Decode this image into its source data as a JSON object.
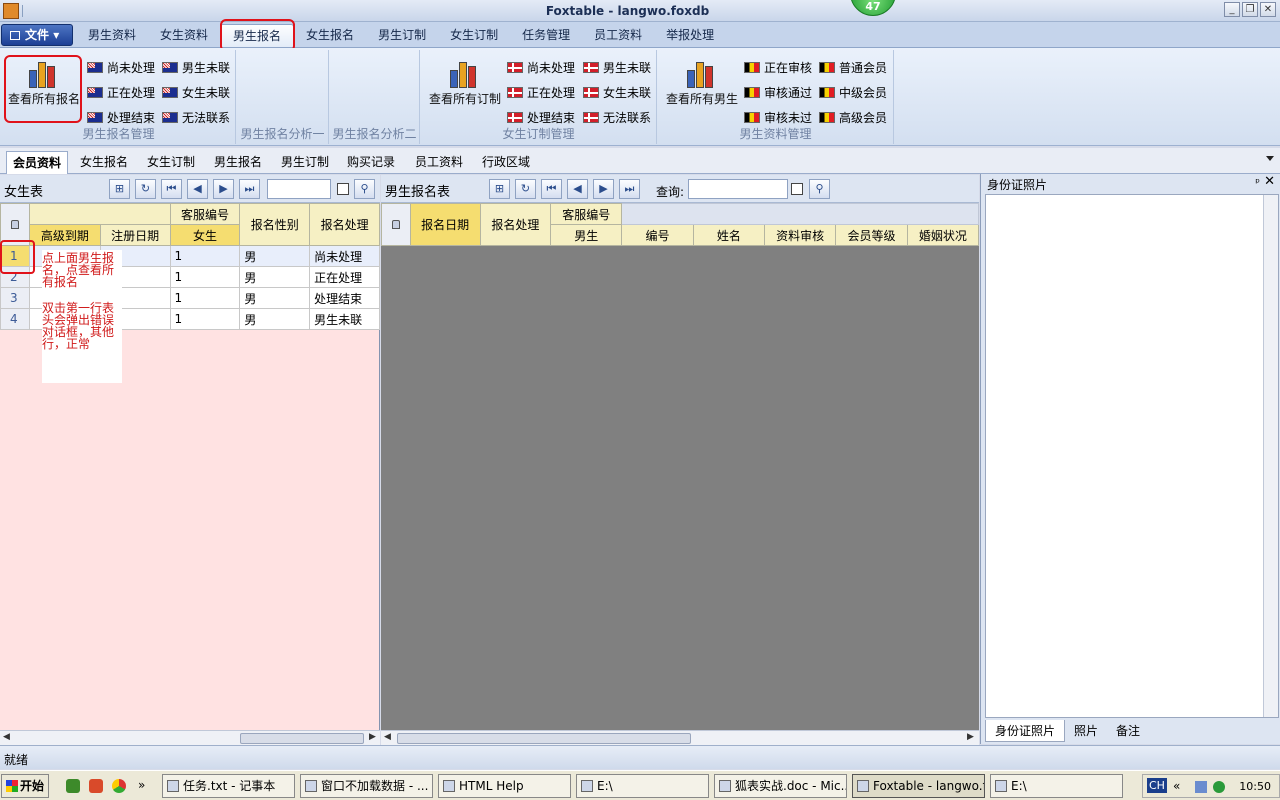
{
  "window": {
    "title": "Foxtable - langwo.foxdb",
    "badge": "47",
    "buttons": [
      "_",
      "❐",
      "✕"
    ]
  },
  "ribbon_tabs": {
    "file": "文件",
    "items": [
      "男生资料",
      "女生资料",
      "男生报名",
      "女生报名",
      "男生订制",
      "女生订制",
      "任务管理",
      "员工资料",
      "举报处理"
    ],
    "active": "男生报名"
  },
  "ribbon": {
    "group1": {
      "label": "男生报名管理",
      "big": "查看所有报名",
      "small": [
        "尚未处理",
        "男生未联",
        "正在处理",
        "女生未联",
        "处理结束",
        "无法联系"
      ]
    },
    "group2": {
      "label": "男生报名分析一"
    },
    "group3": {
      "label": "男生报名分析二"
    },
    "group4": {
      "label": "女生订制管理",
      "big": "查看所有订制",
      "small": [
        "尚未处理",
        "男生未联",
        "正在处理",
        "女生未联",
        "处理结束",
        "无法联系"
      ]
    },
    "group5": {
      "label": "男生资料管理",
      "big": "查看所有男生",
      "small": [
        "正在审核",
        "普通会员",
        "审核通过",
        "中级会员",
        "审核未过",
        "高级会员"
      ]
    }
  },
  "doc_tabs": [
    "会员资料",
    "女生报名",
    "女生订制",
    "男生报名",
    "男生订制",
    "购买记录",
    "员工资料",
    "行政区域"
  ],
  "left_panel": {
    "title": "女生表",
    "headers": {
      "group_kefu": "客服编号",
      "col1": "高级到期",
      "col2": "注册日期",
      "col3": "女生",
      "col4": "报名性别",
      "col5": "报名处理"
    },
    "rows": [
      {
        "num": "1",
        "kefu": "1",
        "gender": "男",
        "status": "尚未处理"
      },
      {
        "num": "2",
        "kefu": "1",
        "gender": "男",
        "status": "正在处理"
      },
      {
        "num": "3",
        "kefu": "1",
        "gender": "男",
        "status": "处理结束"
      },
      {
        "num": "4",
        "kefu": "1",
        "gender": "男",
        "status": "男生未联"
      }
    ],
    "note": {
      "line1": "点上面男生报名，点查看所有报名",
      "line2": "双击第一行表头会弹出错误对话框，其他行，正常"
    }
  },
  "mid_panel": {
    "title": "男生报名表",
    "search_label": "查询:",
    "headers": {
      "col_date": "报名日期",
      "col_proc": "报名处理",
      "group_kefu": "客服编号",
      "sub_male": "男生",
      "col_id": "编号",
      "col_name": "姓名",
      "col_review": "资料审核",
      "col_level": "会员等级",
      "col_marital": "婚姻状况"
    }
  },
  "right_panel": {
    "title": "身份证照片",
    "pin": "ᵖ",
    "close": "✕",
    "tabs": [
      "身份证照片",
      "照片",
      "备注"
    ]
  },
  "status": {
    "text": "就绪"
  },
  "taskbar": {
    "start": "开始",
    "tasks": [
      "任务.txt - 记事本",
      "窗口不加载数据 - ...",
      "HTML Help",
      "E:\\",
      "狐表实战.doc - Mic...",
      "Foxtable - langwo.f...",
      "E:\\"
    ],
    "lang": "CH",
    "time": "10:50",
    "more": "»",
    "tray_more": "«"
  }
}
